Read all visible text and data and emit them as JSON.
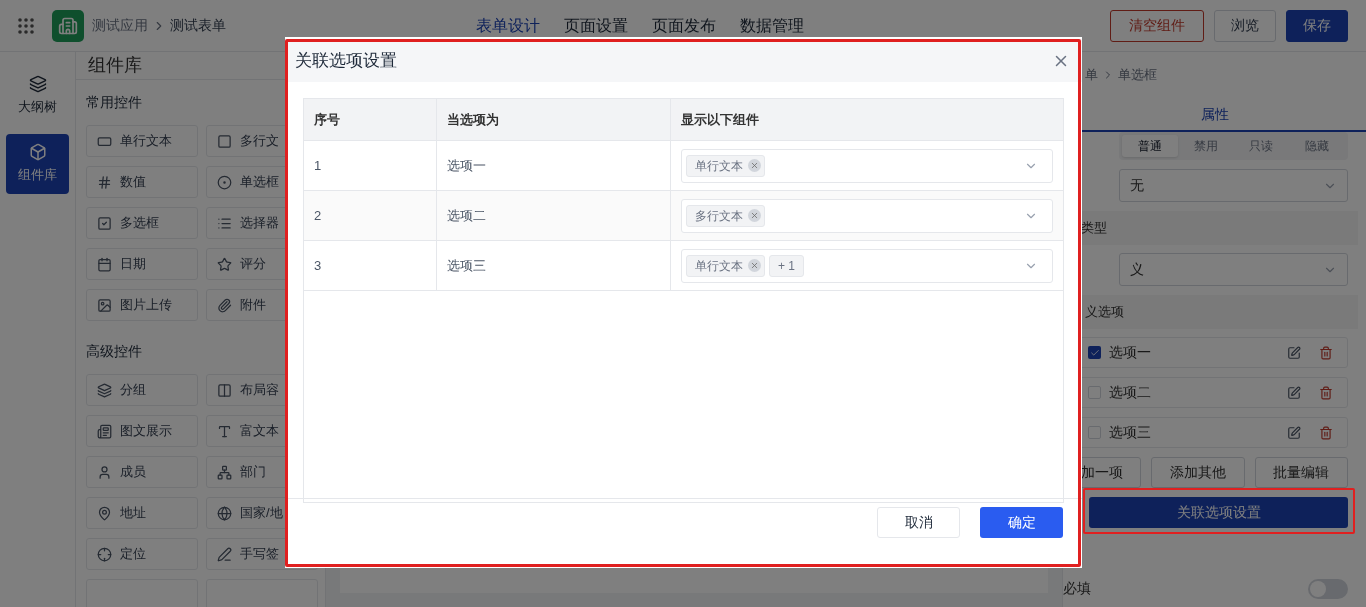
{
  "header": {
    "app_name": "测试应用",
    "page_name": "测试表单",
    "nav_tabs": [
      {
        "label": "表单设计",
        "selected": true
      },
      {
        "label": "页面设置",
        "selected": false
      },
      {
        "label": "页面发布",
        "selected": false
      },
      {
        "label": "数据管理",
        "selected": false
      }
    ],
    "buttons": [
      {
        "label": "清空组件",
        "kind": "danger"
      },
      {
        "label": "浏览",
        "kind": "default"
      },
      {
        "label": "保存",
        "kind": "primary"
      }
    ]
  },
  "left_rail": [
    {
      "label": "大纲树",
      "selected": false
    },
    {
      "label": "组件库",
      "selected": true
    }
  ],
  "library": {
    "title": "组件库",
    "sections": [
      {
        "title": "常用控件",
        "items": [
          "单行文本",
          "多行文",
          "数值",
          "单选框",
          "多选框",
          "选择器",
          "日期",
          "评分",
          "图片上传",
          "附件"
        ]
      },
      {
        "title": "高级控件",
        "items": [
          "分组",
          "布局容",
          "图文展示",
          "富文本",
          "成员",
          "部门",
          "地址",
          "国家/地",
          "定位",
          "手写签"
        ]
      }
    ]
  },
  "properties": {
    "breadcrumb": [
      "单",
      "单选框"
    ],
    "tabs": [
      {
        "label": "属性",
        "selected": true
      }
    ],
    "states": [
      {
        "label": "普通",
        "selected": true
      },
      {
        "label": "禁用",
        "selected": false
      },
      {
        "label": "只读",
        "selected": false
      },
      {
        "label": "隐藏",
        "selected": false
      }
    ],
    "default_select": {
      "value": "无"
    },
    "type_heading": "类型",
    "type_select": {
      "value": "义"
    },
    "options_heading": "义选项",
    "options": [
      {
        "label": "选项一",
        "checked": true
      },
      {
        "label": "选项二",
        "checked": false
      },
      {
        "label": "选项三",
        "checked": false
      }
    ],
    "option_buttons": [
      "加一项",
      "添加其他",
      "批量编辑"
    ],
    "link_button": "关联选项设置",
    "required": {
      "label": "必填",
      "on": false
    }
  },
  "dialog": {
    "title": "关联选项设置",
    "columns": [
      "序号",
      "当选项为",
      "显示以下组件"
    ],
    "rows": [
      {
        "index": "1",
        "option": "选项一",
        "tags": [
          "单行文本"
        ]
      },
      {
        "index": "2",
        "option": "选项二",
        "tags": [
          "多行文本"
        ]
      },
      {
        "index": "3",
        "option": "选项三",
        "tags": [
          "单行文本"
        ],
        "more": "+ 1"
      }
    ],
    "buttons": [
      {
        "label": "取消",
        "kind": "default"
      },
      {
        "label": "确定",
        "kind": "primary"
      }
    ]
  }
}
